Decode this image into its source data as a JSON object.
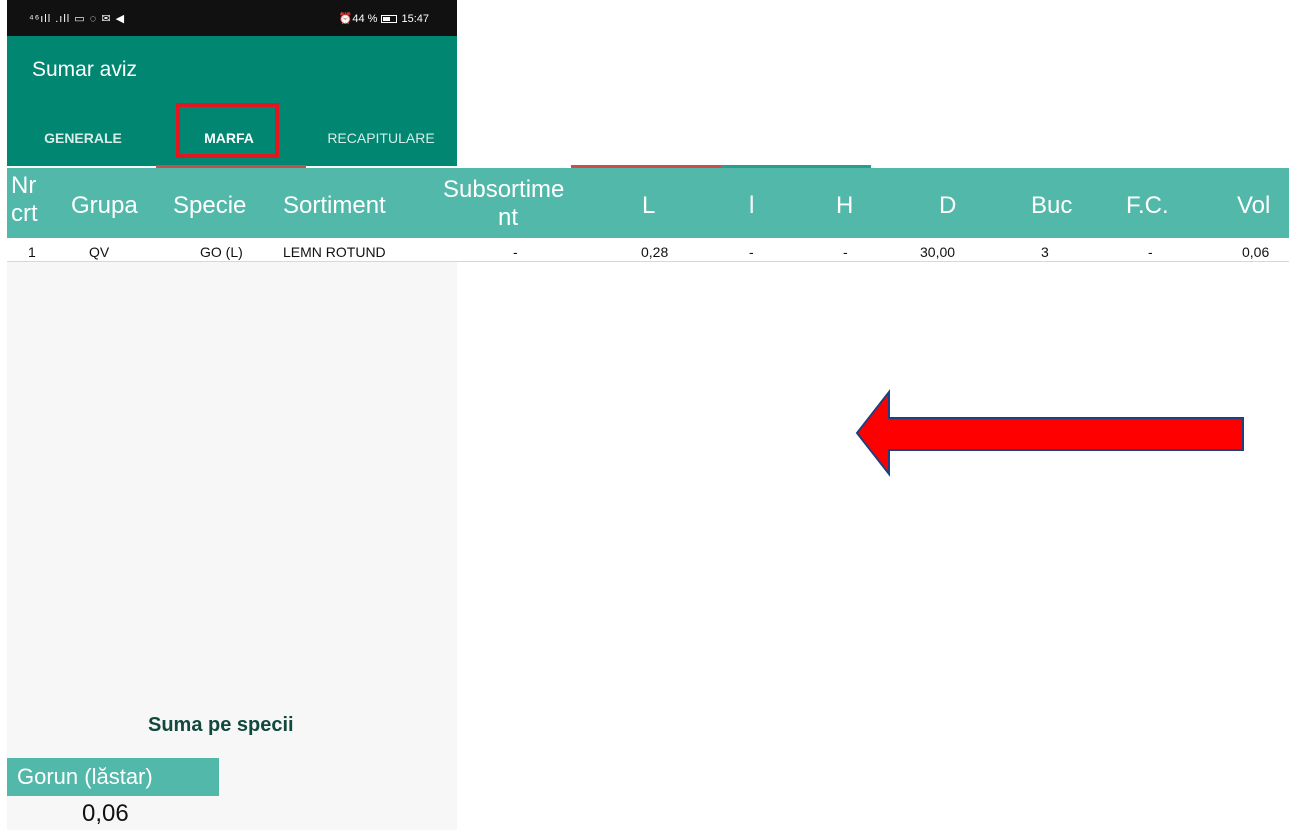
{
  "status_bar": {
    "left": "⁴⁶ıll .ıll ▭ ◌ ✉ ◀",
    "alarm_battery": "⏰44 %",
    "time": "15:47"
  },
  "app_bar": {
    "title": "Sumar aviz"
  },
  "tabs": [
    {
      "label": "GENERALE"
    },
    {
      "label": "MARFA"
    },
    {
      "label": "RECAPITULARE"
    }
  ],
  "table": {
    "headers": {
      "nr_line1": "Nr",
      "nr_line2": "crt",
      "grupa": "Grupa",
      "specie": "Specie",
      "sortiment": "Sortiment",
      "subsortiment_line1": "Subsortime",
      "subsortiment_line2": "nt",
      "L": "L",
      "l": "l",
      "H": "H",
      "D": "D",
      "buc": "Buc",
      "fc": "F.C.",
      "vol": "Vol"
    },
    "rows": [
      {
        "nr": "1",
        "grupa": "QV",
        "specie": "GO (L)",
        "sortiment": "LEMN ROTUND",
        "subsortiment": "-",
        "L": "0,28",
        "l": "-",
        "H": "-",
        "D": "30,00",
        "buc": "3",
        "fc": "-",
        "vol": "0,06"
      }
    ]
  },
  "summary": {
    "title": "Suma pe specii",
    "species_name": "Gorun (lăstar)",
    "species_value": "0,06"
  },
  "colors": {
    "app_bar": "#018672",
    "table_header": "#52b8a9",
    "highlight": "#e3161f",
    "arrow_fill": "#ff0000",
    "arrow_stroke": "#1f3f80"
  }
}
